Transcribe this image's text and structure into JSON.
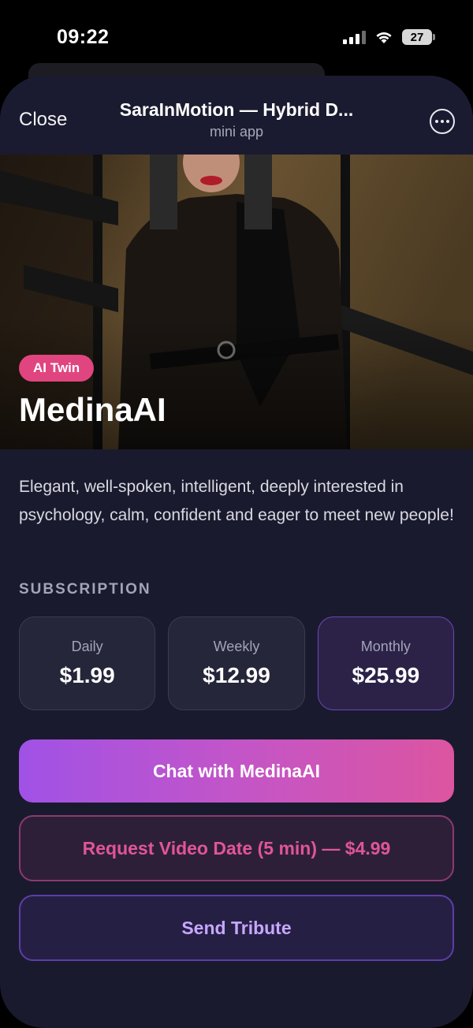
{
  "status_bar": {
    "time": "09:22",
    "battery": "27"
  },
  "header": {
    "close_label": "Close",
    "title": "SaraInMotion — Hybrid D...",
    "subtitle": "mini app",
    "more_icon": "ellipsis-circle-icon"
  },
  "hero": {
    "badge": "AI Twin",
    "name": "MedinaAI"
  },
  "description": "Elegant, well-spoken, intelligent, deeply interested in psychology, calm, confident and eager to meet new people!",
  "subscription": {
    "label": "SUBSCRIPTION",
    "plans": [
      {
        "name": "Daily",
        "price": "$1.99",
        "selected": false
      },
      {
        "name": "Weekly",
        "price": "$12.99",
        "selected": false
      },
      {
        "name": "Monthly",
        "price": "$25.99",
        "selected": true
      }
    ]
  },
  "actions": {
    "chat": "Chat with MedinaAI",
    "video": "Request Video Date (5 min) — $4.99",
    "tribute": "Send Tribute"
  },
  "colors": {
    "background": "#1a1a2e",
    "badge": "#e0457f",
    "gradient_start": "#a052e6",
    "gradient_end": "#dc55a0",
    "video_text": "#e0559a",
    "tribute_text": "#c6a8ff"
  }
}
